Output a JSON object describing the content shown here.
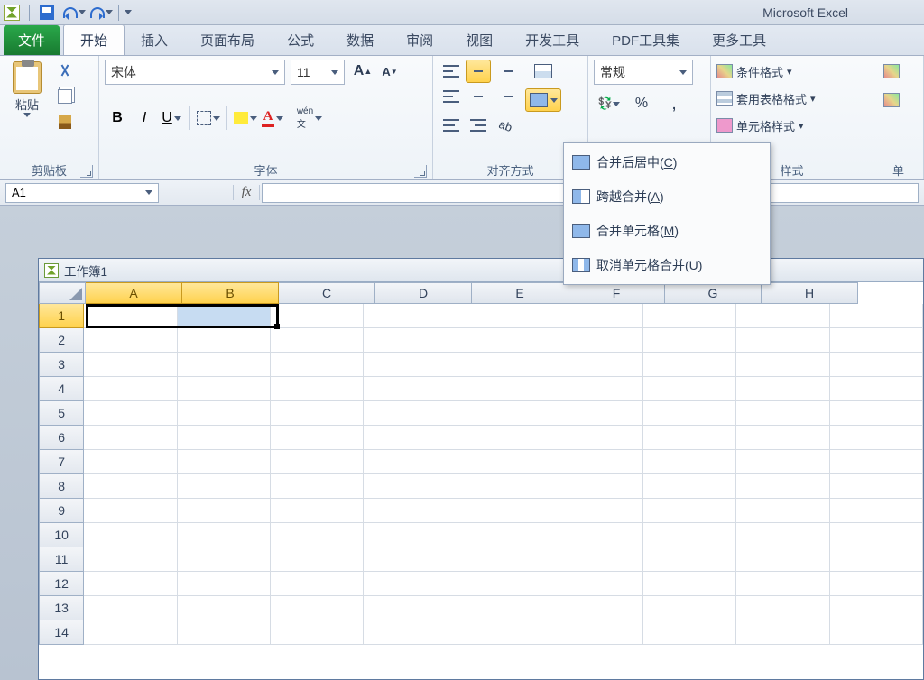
{
  "app_title": "Microsoft Excel",
  "tabs": {
    "file": "文件",
    "home": "开始",
    "insert": "插入",
    "layout": "页面布局",
    "formulas": "公式",
    "data": "数据",
    "review": "审阅",
    "view": "视图",
    "developer": "开发工具",
    "pdf": "PDF工具集",
    "more": "更多工具"
  },
  "groups": {
    "clipboard": "剪贴板",
    "font": "字体",
    "alignment": "对齐方式",
    "styles": "样式",
    "single_partial": "单"
  },
  "clipboard": {
    "paste": "粘贴"
  },
  "font": {
    "name": "宋体",
    "size": "11",
    "bold": "B",
    "italic": "I",
    "underline": "U",
    "grow": "A",
    "shrink": "A",
    "phonetic": "wén"
  },
  "number": {
    "format": "常规",
    "percent": "%",
    "comma": ","
  },
  "styles": {
    "conditional": "条件格式",
    "table": "套用表格格式",
    "cell": "单元格样式"
  },
  "merge_menu": {
    "merge_center": "合并后居中(",
    "merge_center_k": "C",
    "merge_across": "跨越合并(",
    "merge_across_k": "A",
    "merge_cells": "合并单元格(",
    "merge_cells_k": "M",
    "unmerge": "取消单元格合并(",
    "unmerge_k": "U",
    "close_paren": ")"
  },
  "name_box": "A1",
  "fx": "fx",
  "workbook_title": "工作簿1",
  "columns": [
    "A",
    "B",
    "C",
    "D",
    "E",
    "F",
    "G",
    "H"
  ],
  "rows": [
    "1",
    "2",
    "3",
    "4",
    "5",
    "6",
    "7",
    "8",
    "9",
    "10",
    "11",
    "12",
    "13",
    "14"
  ]
}
